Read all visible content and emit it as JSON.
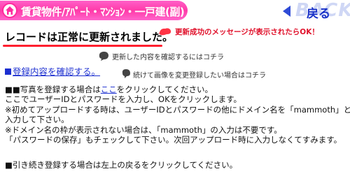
{
  "header": {
    "title": "賃貸物件/ｱﾊﾟｰﾄ・ﾏﾝｼｮﾝ・一戸建(副)",
    "back_label": "戻る",
    "back_watermark": "BACK"
  },
  "message": {
    "success": "レコードは正常に更新されました。"
  },
  "callouts": {
    "success_note": "更新成功のメッセージが表示されたらOK！",
    "confirm_note": "更新した内容を確認するにはコチラ",
    "image_note": "続けて画像を変更登録したい場合はコチラ"
  },
  "links": {
    "confirm": "登録内容を確認する。"
  },
  "instructions": {
    "line1_prefix": "■■写真を登録する場合は",
    "line1_link": "ここ",
    "line1_suffix": "をクリックしてください。",
    "line2": "ここでユーザーIDとパスワードを入力し、OKをクリックします。",
    "line3": "※初めてアップロードする時は、ユーザーIDとパスワードの他にドメイン名を「mammoth」と",
    "line4": "入力して下さい。",
    "line5": "※ドメイン名の枠が表示されない場合は、「mammoth」の入力は不要です。",
    "line6": "「パスワードの保存」もチェックして下さい。次回アップロード時に入力しなくてすみます。"
  },
  "footer": {
    "text": "■引き続き登録する場合は左上の戻るをクリックしてください。"
  },
  "colors": {
    "title_bar": "#ff3aa8",
    "link": "#1c2fd0",
    "success_underline": "#ff1f2f",
    "callout_red": "#e0102a"
  }
}
